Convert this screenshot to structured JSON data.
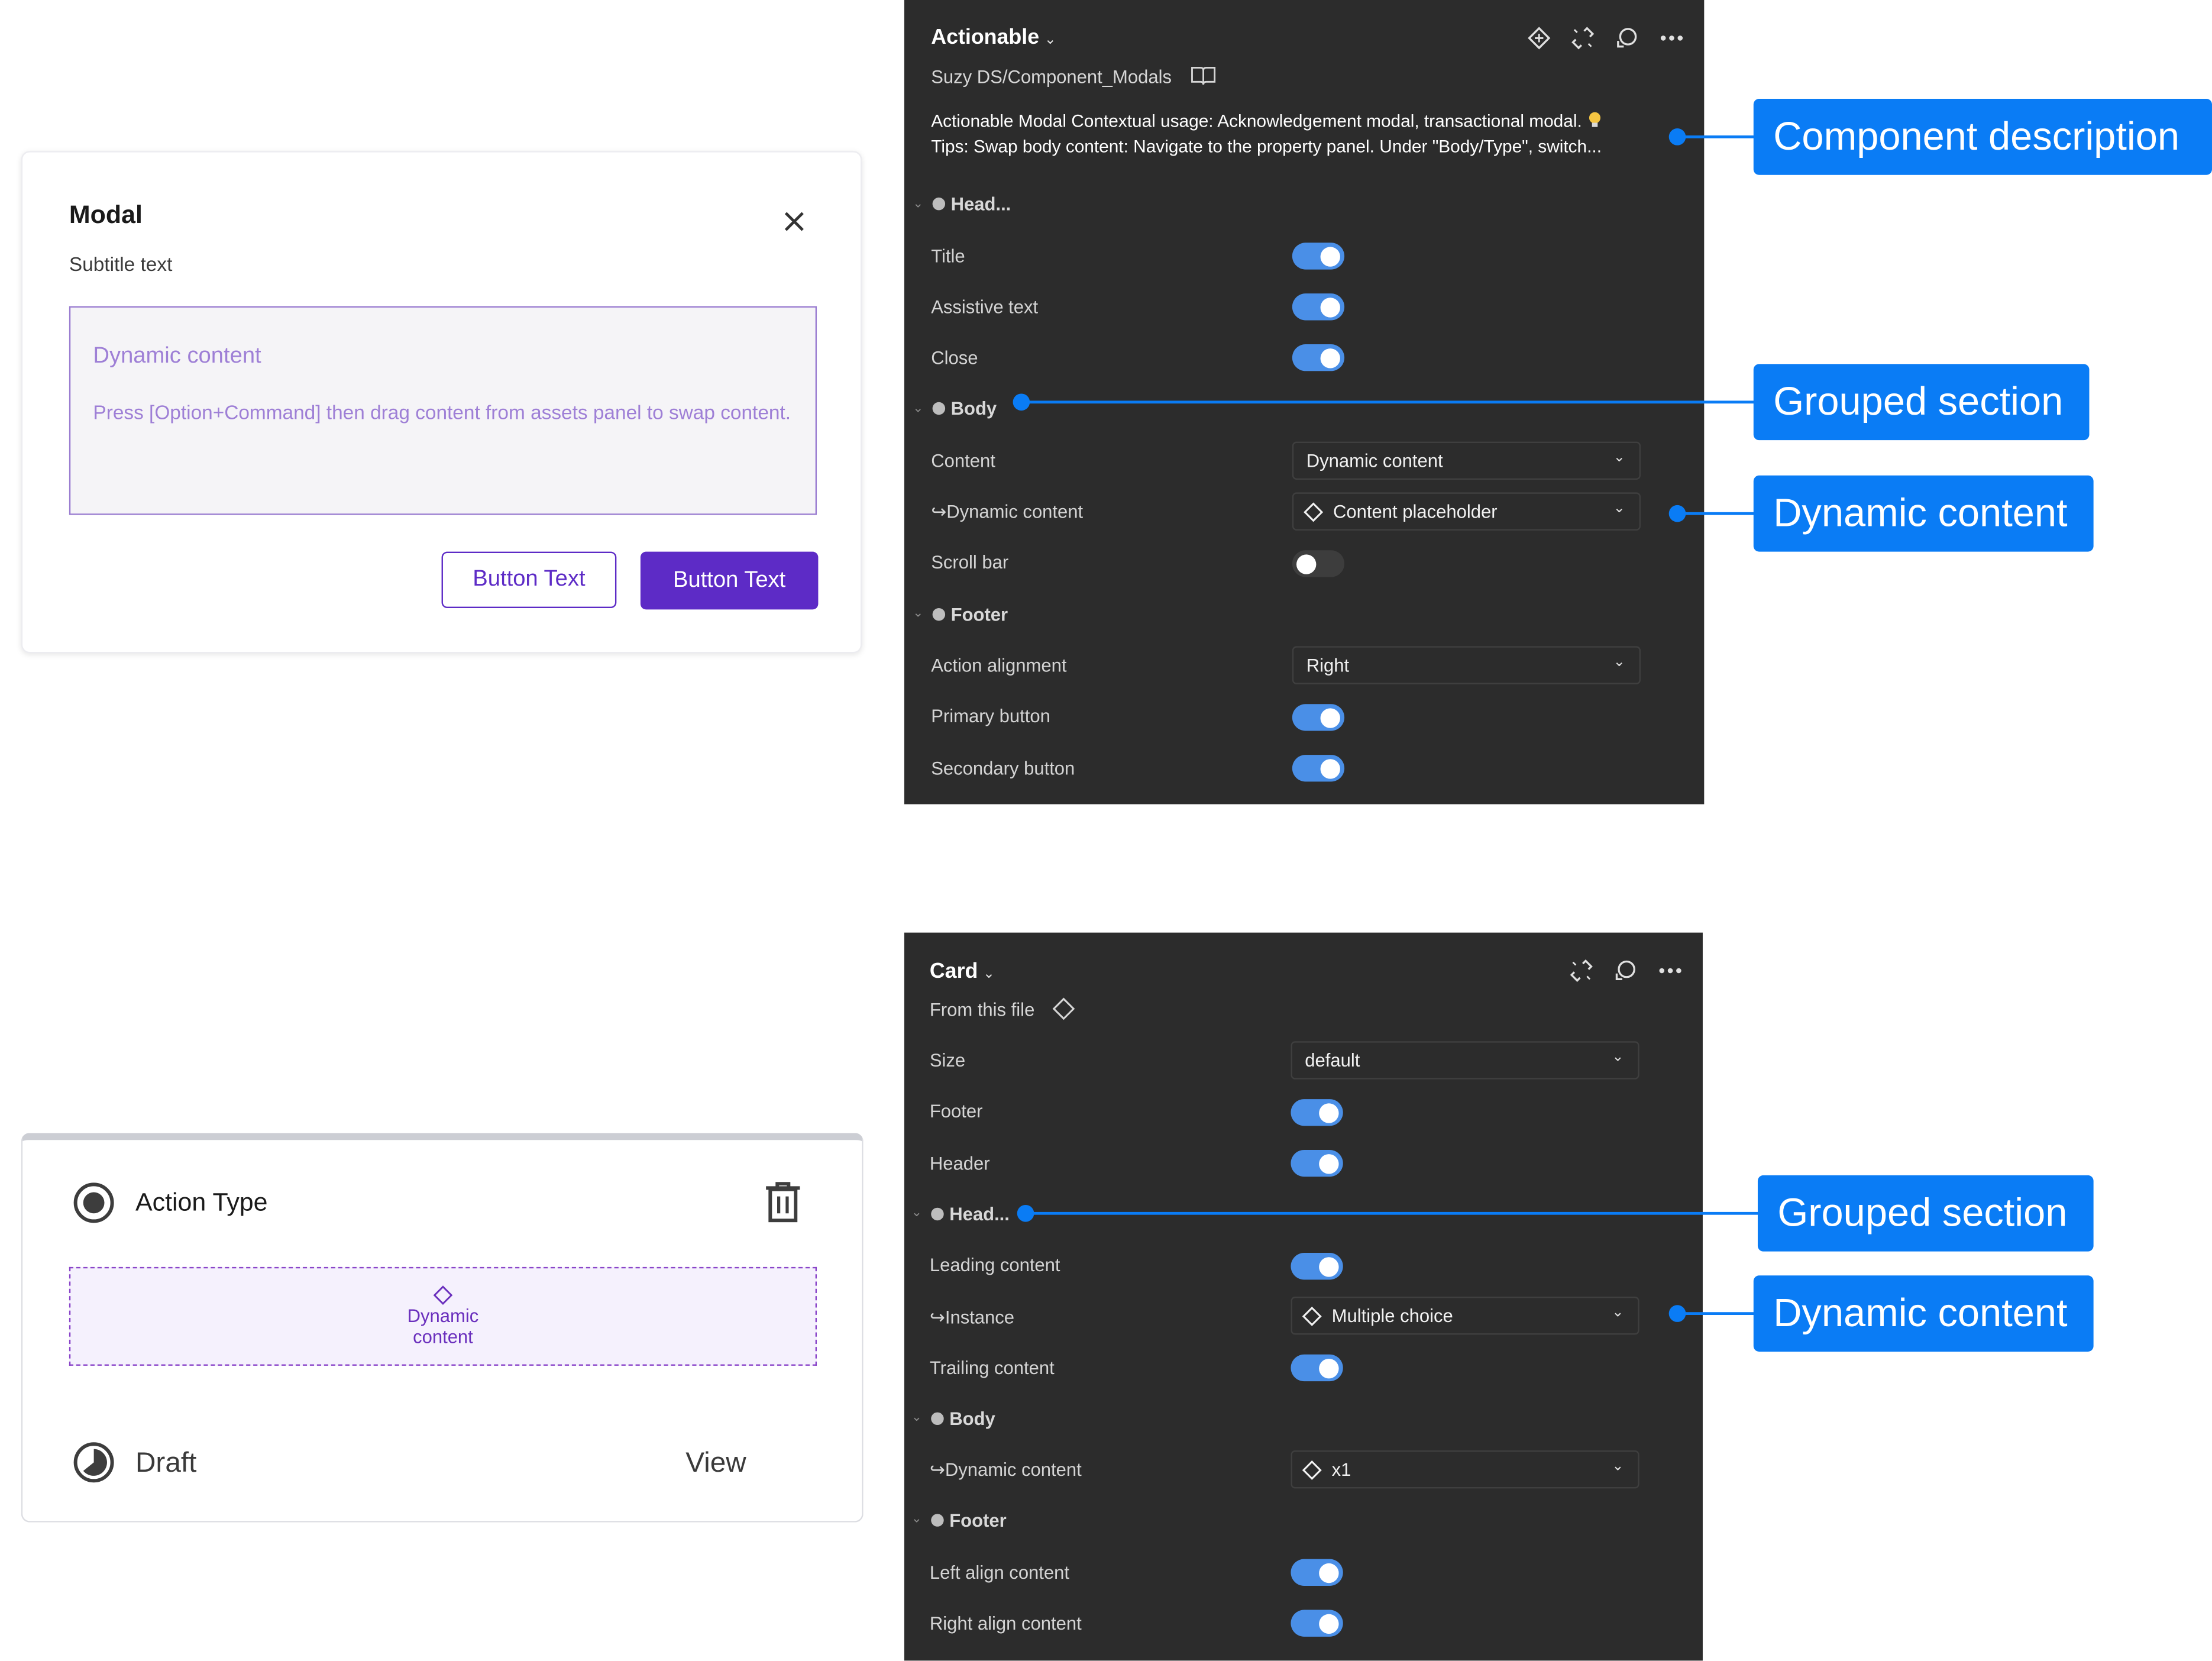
{
  "modal": {
    "title": "Modal",
    "subtitle": "Subtitle text",
    "body_title": "Dynamic content",
    "body_text": "Press [Option+Command] then drag content from assets panel to swap content.",
    "secondary_button": "Button Text",
    "primary_button": "Button Text"
  },
  "action_card": {
    "title": "Action Type",
    "dynamic_label_line1": "Dynamic",
    "dynamic_label_line2": "content",
    "status": "Draft",
    "view_link": "View"
  },
  "panel_actionable": {
    "title": "Actionable",
    "library": "Suzy DS/Component_Modals",
    "description_line1": "Actionable Modal Contextual usage: Acknowledgement modal, transactional modal.",
    "description_line2": "Tips: Swap body content: Navigate to the property panel. Under \"Body/Type\", switch...",
    "sections": {
      "header": "Head...",
      "body": "Body",
      "footer": "Footer"
    },
    "props": {
      "title": {
        "label": "Title",
        "on": true
      },
      "assistive": {
        "label": "Assistive text",
        "on": true
      },
      "close": {
        "label": "Close",
        "on": true
      },
      "content": {
        "label": "Content",
        "value": "Dynamic content"
      },
      "dynamic": {
        "label": "↪Dynamic content",
        "value": "Content placeholder"
      },
      "scrollbar": {
        "label": "Scroll bar",
        "on": false
      },
      "alignment": {
        "label": "Action alignment",
        "value": "Right"
      },
      "primary": {
        "label": "Primary button",
        "on": true
      },
      "secondary": {
        "label": "Secondary button",
        "on": true
      }
    }
  },
  "panel_card": {
    "title": "Card",
    "source": "From this file",
    "sections": {
      "header": "Head...",
      "body": "Body",
      "footer": "Footer"
    },
    "props": {
      "size": {
        "label": "Size",
        "value": "default"
      },
      "footer": {
        "label": "Footer",
        "on": true
      },
      "header": {
        "label": "Header",
        "on": true
      },
      "leading": {
        "label": "Leading content",
        "on": true
      },
      "instance": {
        "label": "↪Instance",
        "value": "Multiple choice"
      },
      "trailing": {
        "label": "Trailing content",
        "on": true
      },
      "dynamic": {
        "label": "↪Dynamic content",
        "value": "x1"
      },
      "left_align": {
        "label": "Left align content",
        "on": true
      },
      "right_align": {
        "label": "Right align content",
        "on": true
      }
    }
  },
  "annotations": {
    "component_description": "Component description",
    "grouped_section_1": "Grouped section",
    "dynamic_content_1": "Dynamic content",
    "grouped_section_2": "Grouped section",
    "dynamic_content_2": "Dynamic content"
  },
  "colors": {
    "accent_purple": "#5d2bc6",
    "annotation_blue": "#0a7cf5",
    "toggle_blue": "#4a8fe7",
    "panel_bg": "#2c2c2c"
  },
  "icons": [
    "close-icon",
    "radio-icon",
    "trash-icon",
    "component-diamond-icon",
    "draft-status-icon",
    "book-icon",
    "detach-instance-icon",
    "unlink-icon",
    "reset-icon",
    "more-icon",
    "chevron-down-icon",
    "lightbulb-icon"
  ]
}
